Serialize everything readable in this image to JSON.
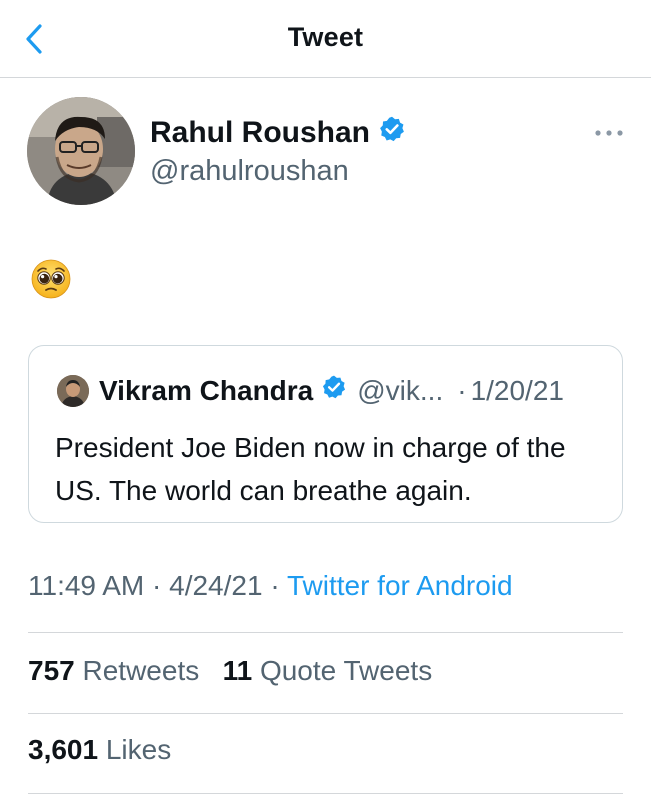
{
  "header": {
    "title": "Tweet",
    "back_icon": "chevron-left-icon"
  },
  "author": {
    "name": "Rahul Roushan",
    "handle": "@rahulroushan",
    "verified": true
  },
  "tweet": {
    "emoji": "🥺"
  },
  "quote": {
    "name": "Vikram Chandra",
    "handle": "@vik...",
    "separator": "·",
    "date": "1/20/21",
    "text": "President Joe Biden now in charge of the US. The world can breathe again."
  },
  "meta": {
    "time": "11:49 AM",
    "sep1": " · ",
    "date": "4/24/21",
    "sep2": " · ",
    "source": "Twitter for Android"
  },
  "stats": {
    "retweets_count": "757",
    "retweets_label": "Retweets",
    "quotes_count": "11",
    "quotes_label": "Quote Tweets",
    "likes_count": "3,601",
    "likes_label": "Likes"
  },
  "colors": {
    "accent": "#1d9bf0",
    "muted": "#536471",
    "text": "#0f1419",
    "divider": "#d4d7da"
  }
}
